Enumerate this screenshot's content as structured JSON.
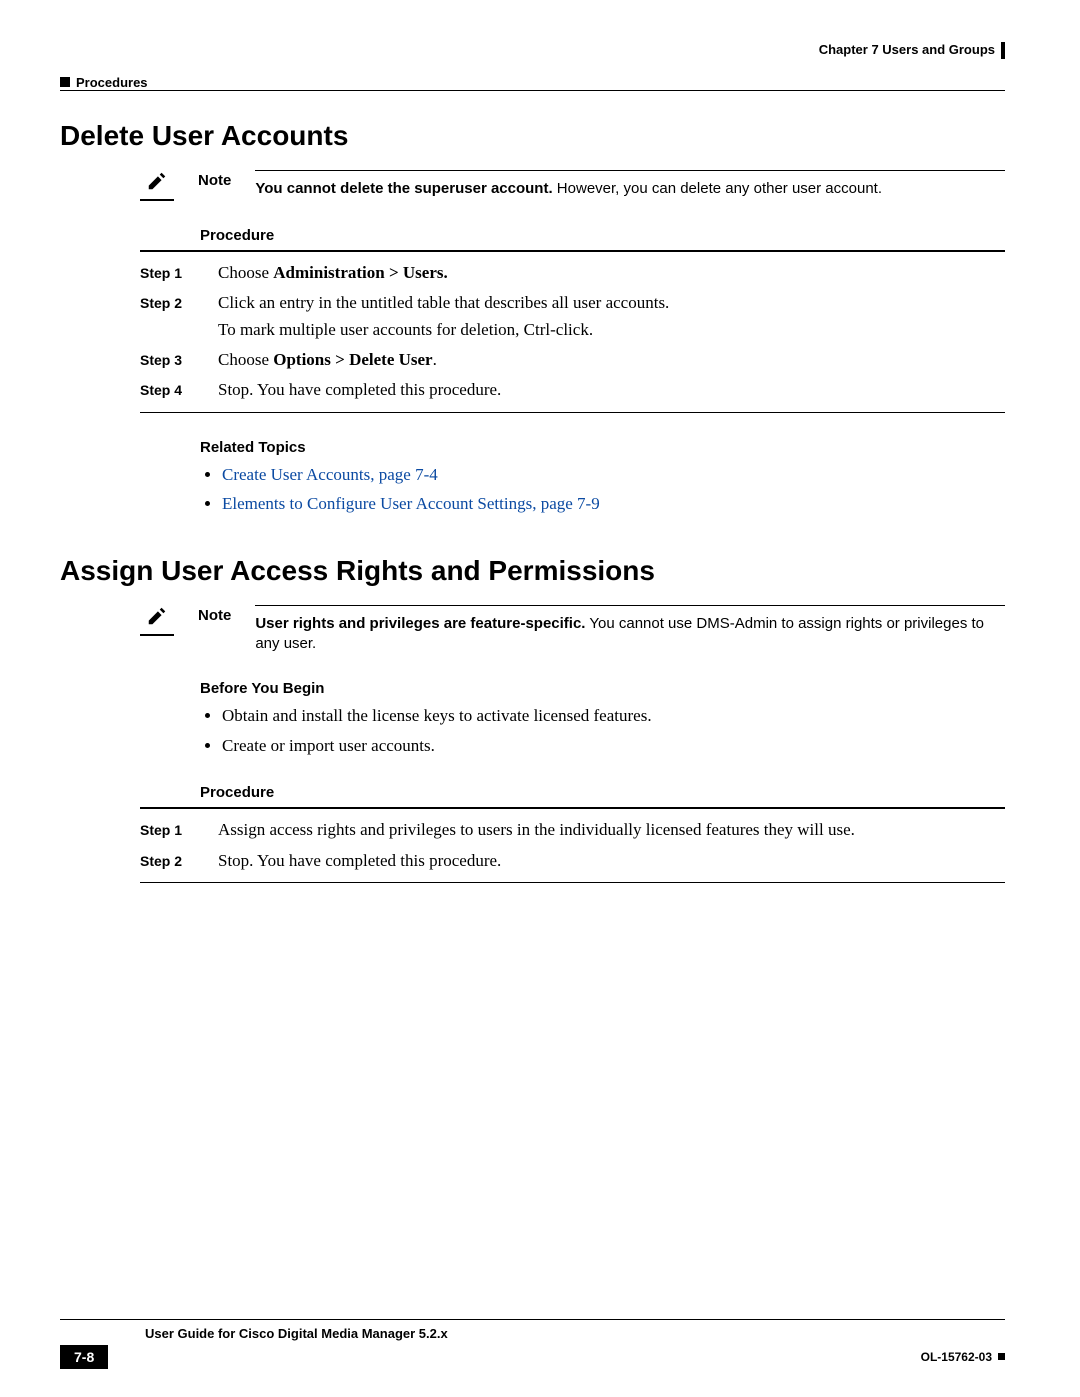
{
  "header": {
    "chapter": "Chapter 7    Users and Groups",
    "breadcrumb": "Procedures"
  },
  "section1": {
    "title": "Delete User Accounts",
    "note": {
      "label": "Note",
      "bold": "You cannot delete the superuser account.",
      "rest": " However, you can delete any other user account."
    },
    "procedure_label": "Procedure",
    "steps": [
      {
        "label": "Step 1",
        "prefix": "Choose ",
        "bold": "Administration > Users.",
        "extra": ""
      },
      {
        "label": "Step 2",
        "prefix": "Click an entry in the untitled table that describes all user accounts.",
        "bold": "",
        "extra": "To mark multiple user accounts for deletion, Ctrl-click."
      },
      {
        "label": "Step 3",
        "prefix": "Choose ",
        "bold": "Options > Delete User",
        "suffix": "."
      },
      {
        "label": "Step 4",
        "prefix": "Stop. You have completed this procedure.",
        "bold": ""
      }
    ],
    "related_label": "Related Topics",
    "related": [
      "Create User Accounts, page 7-4",
      "Elements to Configure User Account Settings, page 7-9"
    ]
  },
  "section2": {
    "title": "Assign User Access Rights and Permissions",
    "note": {
      "label": "Note",
      "bold": "User rights and privileges are feature-specific.",
      "rest": " You cannot use DMS-Admin to assign rights or privileges to any user."
    },
    "before_label": "Before You Begin",
    "before_items": [
      "Obtain and install the license keys to activate licensed features.",
      "Create or import user accounts."
    ],
    "procedure_label": "Procedure",
    "steps": [
      {
        "label": "Step 1",
        "text": "Assign access rights and privileges to users in the individually licensed features they will use."
      },
      {
        "label": "Step 2",
        "text": "Stop. You have completed this procedure."
      }
    ]
  },
  "footer": {
    "doc_title": "User Guide for Cisco Digital Media Manager 5.2.x",
    "page": "7-8",
    "doc_id": "OL-15762-03"
  }
}
